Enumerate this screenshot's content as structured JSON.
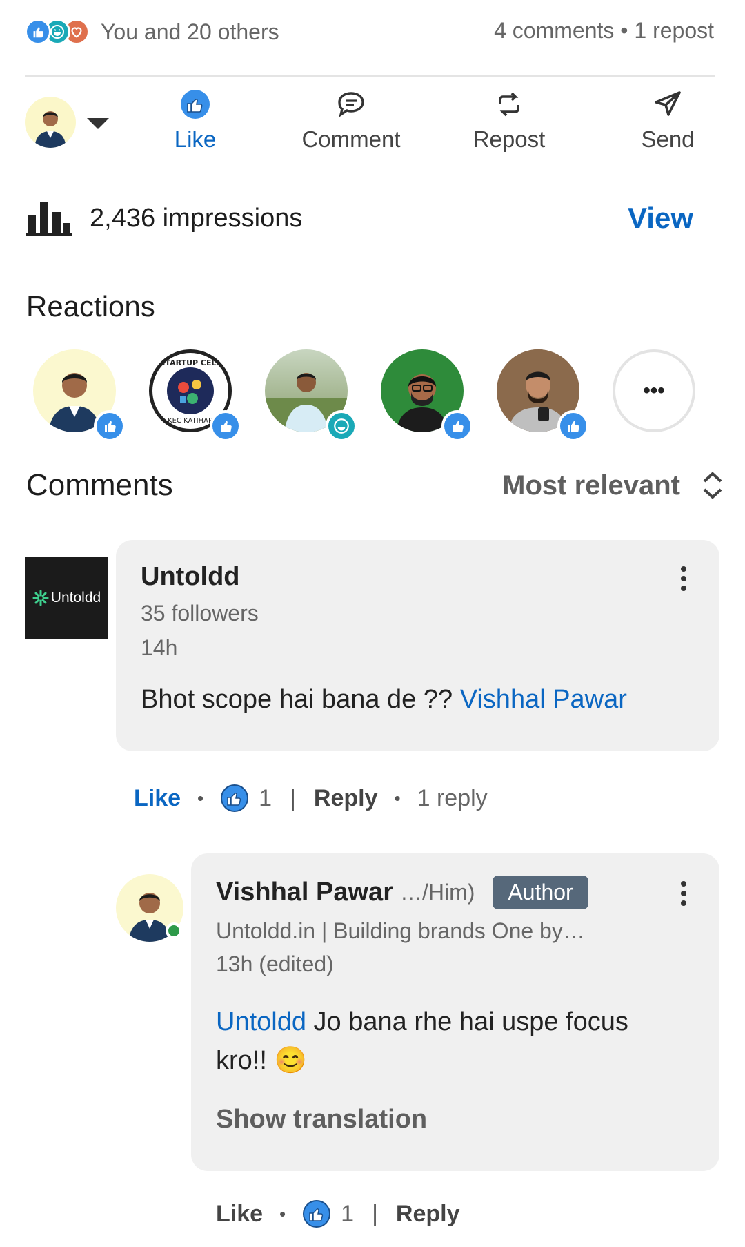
{
  "summary": {
    "reactions_text": "You and 20 others",
    "stats_text": "4 comments • 1 repost"
  },
  "actions": [
    {
      "label": "Like",
      "icon": "thumbs-up-icon",
      "active": true
    },
    {
      "label": "Comment",
      "icon": "comment-icon",
      "active": false
    },
    {
      "label": "Repost",
      "icon": "repost-icon",
      "active": false
    },
    {
      "label": "Send",
      "icon": "send-icon",
      "active": false
    }
  ],
  "impressions": {
    "text": "2,436 impressions",
    "view_label": "View"
  },
  "reactions": {
    "heading": "Reactions",
    "more_label": "•••"
  },
  "comments": {
    "heading": "Comments",
    "sort_label": "Most relevant",
    "items": [
      {
        "author": "Untoldd",
        "logo_text": "Untoldd",
        "subtitle": "35 followers",
        "time": "14h",
        "text_plain": "Bhot scope hai bana de ?? ",
        "mention": "Vishhal Pawar",
        "like_label": "Like",
        "like_count": "1",
        "reply_label": "Reply",
        "reply_count": "1 reply"
      }
    ],
    "reply": {
      "author": "Vishhal Pawar",
      "pronoun": "…/Him)",
      "badge": "Author",
      "subtitle": "Untoldd.in | Building brands One by…",
      "time": "13h (edited)",
      "mention": "Untoldd",
      "text_line1": " Jo bana rhe hai uspe focus",
      "text_line2": "kro!! ",
      "emoji": "😊",
      "translate_label": "Show translation",
      "like_label": "Like",
      "like_count": "1",
      "reply_label": "Reply"
    }
  },
  "colors": {
    "accent": "#0a66c2",
    "like_blue": "#378fe9",
    "celebrate": "#44712e",
    "funny": "#1aa9b7",
    "love": "#df704d",
    "author_badge": "#56687a"
  }
}
